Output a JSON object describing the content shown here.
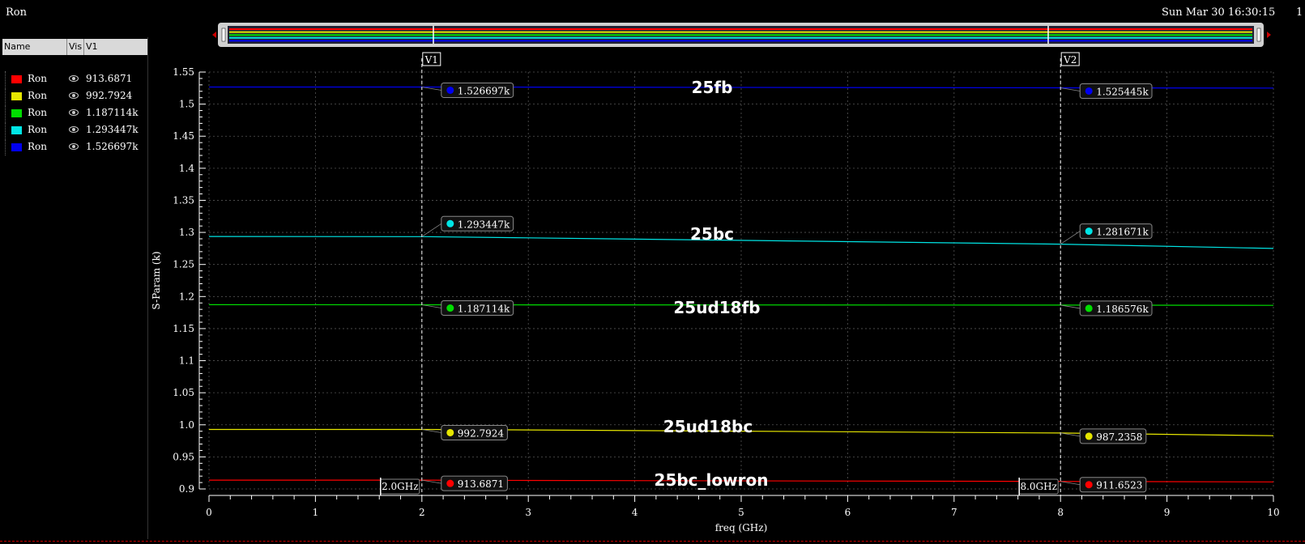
{
  "window": {
    "title": "Ron",
    "date": "Sun Mar 30 16:30:15",
    "page_number": "1"
  },
  "legend": {
    "columns": [
      "Name",
      "Vis",
      "V1"
    ],
    "rows": [
      {
        "name": "Ron",
        "value": "913.6871",
        "color": "#ff0000"
      },
      {
        "name": "Ron",
        "value": "992.7924",
        "color": "#e6e600"
      },
      {
        "name": "Ron",
        "value": "1.187114k",
        "color": "#00dd00"
      },
      {
        "name": "Ron",
        "value": "1.293447k",
        "color": "#00e5e5"
      },
      {
        "name": "Ron",
        "value": "1.526697k",
        "color": "#0000ee"
      }
    ]
  },
  "chart_data": {
    "type": "line",
    "xlabel": "freq (GHz)",
    "ylabel": "S-Param (k)",
    "xlim": [
      0,
      10
    ],
    "ylim": [
      0.9,
      1.55
    ],
    "xticks": [
      "0",
      "1",
      "2",
      "3",
      "4",
      "5",
      "6",
      "7",
      "8",
      "9",
      "10"
    ],
    "yticks": [
      "0.9",
      "0.95",
      "1.0",
      "1.05",
      "1.1",
      "1.15",
      "1.2",
      "1.25",
      "1.3",
      "1.35",
      "1.4",
      "1.45",
      "1.5",
      "1.55"
    ],
    "grid": true,
    "series": [
      {
        "name": "25bc_lowron",
        "color": "#ff0000",
        "x": [
          0,
          2,
          3,
          8,
          10
        ],
        "y": [
          0.9137,
          0.9137,
          0.9133,
          0.9117,
          0.911
        ]
      },
      {
        "name": "25ud18bc",
        "color": "#e6e600",
        "x": [
          0,
          2,
          3,
          8,
          10
        ],
        "y": [
          0.9928,
          0.9928,
          0.992,
          0.9872,
          0.983
        ]
      },
      {
        "name": "25ud18fb",
        "color": "#00dd00",
        "x": [
          0,
          2,
          3,
          8,
          10
        ],
        "y": [
          1.1872,
          1.1871,
          1.187,
          1.1866,
          1.1862
        ]
      },
      {
        "name": "25bc",
        "color": "#00e5e5",
        "x": [
          0,
          2,
          3,
          8,
          10
        ],
        "y": [
          1.2936,
          1.2934,
          1.2915,
          1.2817,
          1.275
        ]
      },
      {
        "name": "25fb",
        "color": "#0000ee",
        "x": [
          0,
          2,
          3,
          8,
          10
        ],
        "y": [
          1.5267,
          1.5267,
          1.5265,
          1.5254,
          1.525
        ]
      }
    ],
    "curve_labels": [
      "25fb",
      "25bc",
      "25ud18fb",
      "25ud18bc",
      "25bc_lowron"
    ],
    "markers": [
      {
        "label": "V1",
        "x": 2,
        "x_readout": "2.0GHz",
        "values": [
          "913.6871",
          "992.7924",
          "1.187114k",
          "1.293447k",
          "1.526697k"
        ]
      },
      {
        "label": "V2",
        "x": 8,
        "x_readout": "8.0GHz",
        "values": [
          "911.6523",
          "987.2358",
          "1.186576k",
          "1.281671k",
          "1.525445k"
        ]
      }
    ]
  }
}
